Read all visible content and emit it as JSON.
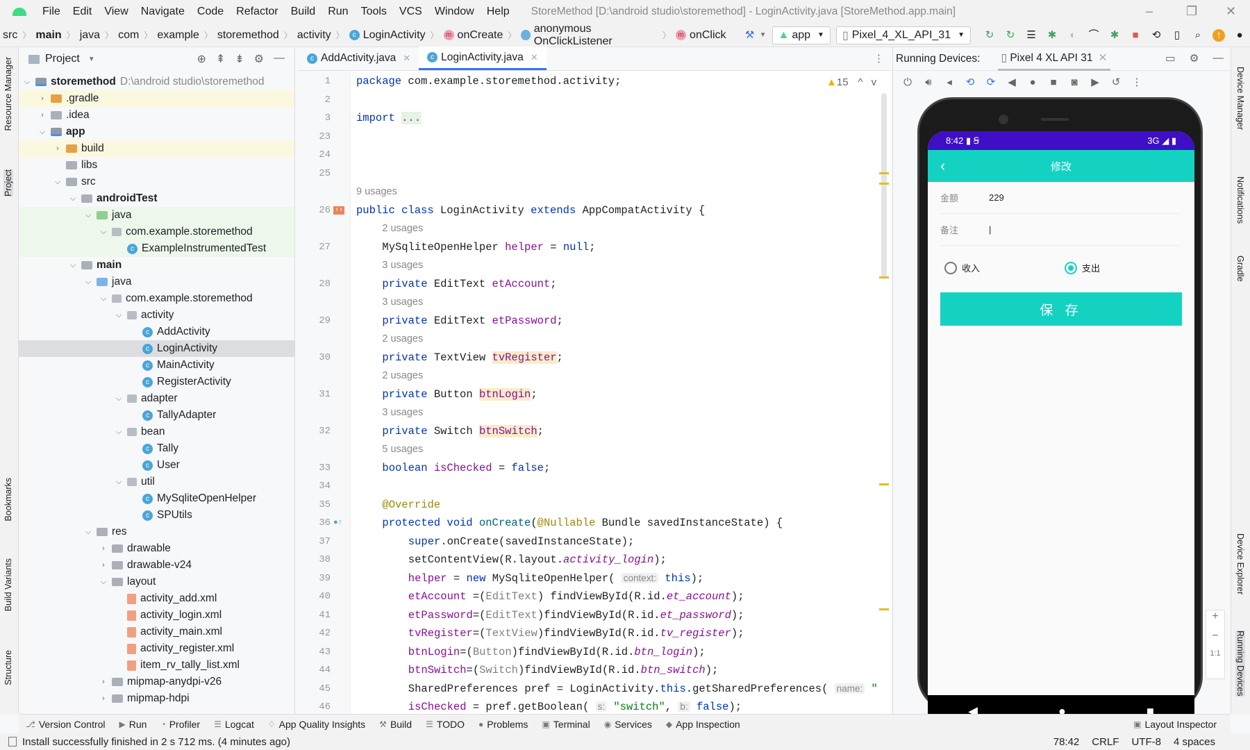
{
  "menubar": {
    "items": [
      "File",
      "Edit",
      "View",
      "Navigate",
      "Code",
      "Refactor",
      "Build",
      "Run",
      "Tools",
      "VCS",
      "Window",
      "Help"
    ],
    "title": "StoreMethod [D:\\android studio\\storemethod] - LoginActivity.java [StoreMethod.app.main]"
  },
  "breadcrumb": {
    "items": [
      "src",
      "main",
      "java",
      "com",
      "example",
      "storemethod",
      "activity"
    ],
    "class": "LoginActivity",
    "method": "onCreate",
    "anon": "anonymous OnClickListener",
    "inner": "onClick"
  },
  "toolbar": {
    "config": "app",
    "device": "Pixel_4_XL_API_31"
  },
  "left_strip": [
    "Resource Manager",
    "Project",
    "Bookmarks",
    "Build Variants",
    "Structure"
  ],
  "right_strip": [
    "Device Manager",
    "Notifications",
    "Gradle",
    "Device Explorer",
    "Running Devices"
  ],
  "project": {
    "title": "Project",
    "tree": [
      {
        "d": 0,
        "a": "v",
        "i": "mod",
        "l": "storemethod",
        "b": true,
        "p": "D:\\android studio\\storemethod"
      },
      {
        "d": 1,
        "a": ">",
        "i": "orange",
        "l": ".gradle",
        "bg": "#fbf8e0"
      },
      {
        "d": 1,
        "a": ">",
        "i": "",
        "l": ".idea"
      },
      {
        "d": 1,
        "a": "v",
        "i": "mod",
        "l": "app",
        "b": true
      },
      {
        "d": 2,
        "a": ">",
        "i": "orange",
        "l": "build",
        "bg": "#fbf8e0"
      },
      {
        "d": 2,
        "a": "",
        "i": "",
        "l": "libs"
      },
      {
        "d": 2,
        "a": "v",
        "i": "",
        "l": "src"
      },
      {
        "d": 3,
        "a": "v",
        "i": "",
        "l": "androidTest",
        "b": true
      },
      {
        "d": 4,
        "a": "v",
        "i": "green",
        "l": "java",
        "bg": "#eef7ec"
      },
      {
        "d": 5,
        "a": "v",
        "i": "pkg",
        "l": "com.example.storemethod",
        "bg": "#eef7ec"
      },
      {
        "d": 6,
        "a": "",
        "i": "class",
        "l": "ExampleInstrumentedTest",
        "bg": "#eef7ec"
      },
      {
        "d": 3,
        "a": "v",
        "i": "",
        "l": "main",
        "b": true
      },
      {
        "d": 4,
        "a": "v",
        "i": "blue",
        "l": "java"
      },
      {
        "d": 5,
        "a": "v",
        "i": "pkg",
        "l": "com.example.storemethod"
      },
      {
        "d": 6,
        "a": "v",
        "i": "pkg",
        "l": "activity"
      },
      {
        "d": 7,
        "a": "",
        "i": "class",
        "l": "AddActivity"
      },
      {
        "d": 7,
        "a": "",
        "i": "class",
        "l": "LoginActivity",
        "bg": "#dcdde0"
      },
      {
        "d": 7,
        "a": "",
        "i": "class",
        "l": "MainActivity"
      },
      {
        "d": 7,
        "a": "",
        "i": "class",
        "l": "RegisterActivity"
      },
      {
        "d": 6,
        "a": "v",
        "i": "pkg",
        "l": "adapter"
      },
      {
        "d": 7,
        "a": "",
        "i": "class",
        "l": "TallyAdapter"
      },
      {
        "d": 6,
        "a": "v",
        "i": "pkg",
        "l": "bean"
      },
      {
        "d": 7,
        "a": "",
        "i": "class",
        "l": "Tally"
      },
      {
        "d": 7,
        "a": "",
        "i": "class",
        "l": "User"
      },
      {
        "d": 6,
        "a": "v",
        "i": "pkg",
        "l": "util"
      },
      {
        "d": 7,
        "a": "",
        "i": "class",
        "l": "MySqliteOpenHelper"
      },
      {
        "d": 7,
        "a": "",
        "i": "class",
        "l": "SPUtils"
      },
      {
        "d": 4,
        "a": "v",
        "i": "",
        "l": "res"
      },
      {
        "d": 5,
        "a": ">",
        "i": "",
        "l": "drawable"
      },
      {
        "d": 5,
        "a": ">",
        "i": "",
        "l": "drawable-v24"
      },
      {
        "d": 5,
        "a": "v",
        "i": "",
        "l": "layout"
      },
      {
        "d": 6,
        "a": "",
        "i": "xml",
        "l": "activity_add.xml"
      },
      {
        "d": 6,
        "a": "",
        "i": "xml",
        "l": "activity_login.xml"
      },
      {
        "d": 6,
        "a": "",
        "i": "xml",
        "l": "activity_main.xml"
      },
      {
        "d": 6,
        "a": "",
        "i": "xml",
        "l": "activity_register.xml"
      },
      {
        "d": 6,
        "a": "",
        "i": "xml",
        "l": "item_rv_tally_list.xml"
      },
      {
        "d": 5,
        "a": ">",
        "i": "",
        "l": "mipmap-anydpi-v26"
      },
      {
        "d": 5,
        "a": ">",
        "i": "",
        "l": "mipmap-hdpi"
      }
    ]
  },
  "editor": {
    "tabs": [
      "AddActivity.java",
      "LoginActivity.java"
    ],
    "warnings": "15",
    "rows": [
      {
        "n": "1",
        "i": 0,
        "t": [
          [
            "kw",
            "package "
          ],
          [
            "",
            "com.example.storemethod.activity;"
          ]
        ]
      },
      {
        "n": "2",
        "i": 0,
        "t": []
      },
      {
        "n": "3",
        "i": 0,
        "t": [
          [
            "kw",
            "import "
          ],
          [
            "fold",
            "..."
          ]
        ]
      },
      {
        "n": "23",
        "i": 0,
        "t": []
      },
      {
        "n": "24",
        "i": 0,
        "t": []
      },
      {
        "n": "25",
        "i": 0,
        "t": []
      },
      {
        "u": "9 usages",
        "i": 0
      },
      {
        "n": "26",
        "i": 0,
        "t": [
          [
            "kw",
            "public class "
          ],
          [
            "",
            "LoginActivity "
          ],
          [
            "kw",
            "extends "
          ],
          [
            "",
            "AppCompatActivity {"
          ]
        ]
      },
      {
        "u": "2 usages",
        "i": 1
      },
      {
        "n": "27",
        "i": 1,
        "t": [
          [
            "",
            "MySqliteOpenHelper "
          ],
          [
            "fld",
            "helper"
          ],
          [
            "",
            " = "
          ],
          [
            "kw",
            "null"
          ],
          [
            "",
            ";"
          ]
        ]
      },
      {
        "u": "3 usages",
        "i": 1
      },
      {
        "n": "28",
        "i": 1,
        "t": [
          [
            "kw",
            "private "
          ],
          [
            "",
            "EditText "
          ],
          [
            "fld",
            "etAccount"
          ],
          [
            "",
            ";"
          ]
        ]
      },
      {
        "u": "3 usages",
        "i": 1
      },
      {
        "n": "29",
        "i": 1,
        "t": [
          [
            "kw",
            "private "
          ],
          [
            "",
            "EditText "
          ],
          [
            "fld",
            "etPassword"
          ],
          [
            "",
            ";"
          ]
        ]
      },
      {
        "u": "2 usages",
        "i": 1
      },
      {
        "n": "30",
        "i": 1,
        "t": [
          [
            "kw",
            "private "
          ],
          [
            "",
            "TextView "
          ],
          [
            "fld hl",
            "tvRegister"
          ],
          [
            "",
            ";"
          ]
        ]
      },
      {
        "u": "2 usages",
        "i": 1
      },
      {
        "n": "31",
        "i": 1,
        "t": [
          [
            "kw",
            "private "
          ],
          [
            "",
            "Button "
          ],
          [
            "fld hl",
            "btnLogin"
          ],
          [
            "",
            ";"
          ]
        ]
      },
      {
        "u": "3 usages",
        "i": 1
      },
      {
        "n": "32",
        "i": 1,
        "t": [
          [
            "kw",
            "private "
          ],
          [
            "",
            "Switch "
          ],
          [
            "fld hl",
            "btnSwitch"
          ],
          [
            "",
            ";"
          ]
        ]
      },
      {
        "u": "5 usages",
        "i": 1
      },
      {
        "n": "33",
        "i": 1,
        "t": [
          [
            "kw",
            "boolean "
          ],
          [
            "fld",
            "isChecked"
          ],
          [
            "",
            " = "
          ],
          [
            "kw",
            "false"
          ],
          [
            "",
            ";"
          ]
        ]
      },
      {
        "n": "34",
        "i": 1,
        "t": []
      },
      {
        "n": "35",
        "i": 1,
        "t": [
          [
            "ann",
            "@Override"
          ]
        ]
      },
      {
        "n": "36",
        "i": 1,
        "t": [
          [
            "kw",
            "protected void "
          ],
          [
            "mth",
            "onCreate"
          ],
          [
            "",
            "("
          ],
          [
            "ann",
            "@Nullable"
          ],
          [
            "",
            " Bundle savedInstanceState) {"
          ]
        ]
      },
      {
        "n": "37",
        "i": 2,
        "t": [
          [
            "kw",
            "super"
          ],
          [
            "",
            ".onCreate(savedInstanceState);"
          ]
        ]
      },
      {
        "n": "38",
        "i": 2,
        "t": [
          [
            "",
            "setContentView(R.layout."
          ],
          [
            "it",
            "activity_login"
          ],
          [
            "",
            ");"
          ]
        ]
      },
      {
        "n": "39",
        "i": 2,
        "t": [
          [
            "fld",
            "helper"
          ],
          [
            "",
            " = "
          ],
          [
            "kw",
            "new "
          ],
          [
            "",
            "MySqliteOpenHelper( "
          ],
          [
            "hint",
            "context:"
          ],
          [
            "kw",
            " this"
          ],
          [
            "",
            ");"
          ]
        ]
      },
      {
        "n": "40",
        "i": 2,
        "t": [
          [
            "fld",
            "etAccount"
          ],
          [
            "",
            " =("
          ],
          [
            "cast",
            "EditText"
          ],
          [
            "",
            ") findViewById(R.id."
          ],
          [
            "it",
            "et_account"
          ],
          [
            "",
            ");"
          ]
        ]
      },
      {
        "n": "41",
        "i": 2,
        "t": [
          [
            "fld",
            "etPassword"
          ],
          [
            "",
            "=("
          ],
          [
            "cast",
            "EditText"
          ],
          [
            "",
            ")findViewById(R.id."
          ],
          [
            "it",
            "et_password"
          ],
          [
            "",
            ");"
          ]
        ]
      },
      {
        "n": "42",
        "i": 2,
        "t": [
          [
            "fld",
            "tvRegister"
          ],
          [
            "",
            "=("
          ],
          [
            "cast",
            "TextView"
          ],
          [
            "",
            ")findViewById(R.id."
          ],
          [
            "it",
            "tv_register"
          ],
          [
            "",
            ");"
          ]
        ]
      },
      {
        "n": "43",
        "i": 2,
        "t": [
          [
            "fld",
            "btnLogin"
          ],
          [
            "",
            "=("
          ],
          [
            "cast",
            "Button"
          ],
          [
            "",
            ")findViewById(R.id."
          ],
          [
            "it",
            "btn_login"
          ],
          [
            "",
            ");"
          ]
        ]
      },
      {
        "n": "44",
        "i": 2,
        "t": [
          [
            "fld",
            "btnSwitch"
          ],
          [
            "",
            "=("
          ],
          [
            "cast",
            "Switch"
          ],
          [
            "",
            ")findViewById(R.id."
          ],
          [
            "it",
            "btn_switch"
          ],
          [
            "",
            ");"
          ]
        ]
      },
      {
        "n": "45",
        "i": 2,
        "t": [
          [
            "",
            "SharedPreferences pref = LoginActivity."
          ],
          [
            "kw",
            "this"
          ],
          [
            "",
            ".getSharedPreferences( "
          ],
          [
            "hint",
            "name:"
          ],
          [
            "str",
            " \""
          ]
        ]
      },
      {
        "n": "46",
        "i": 2,
        "t": [
          [
            "fld",
            "isChecked"
          ],
          [
            "",
            " = pref.getBoolean( "
          ],
          [
            "hint",
            "s:"
          ],
          [
            "str",
            " \"switch\""
          ],
          [
            "",
            ", "
          ],
          [
            "hint",
            "b:"
          ],
          [
            "kw",
            " false"
          ],
          [
            "",
            ");"
          ]
        ]
      }
    ]
  },
  "running": {
    "label": "Running Devices:",
    "device_tab": "Pixel 4 XL API 31",
    "zoom": [
      "+",
      "−",
      "1:1"
    ]
  },
  "phone": {
    "time": "8:42",
    "network": "3G",
    "title": "修改",
    "amount_label": "金额",
    "amount_value": "229",
    "note_label": "备注",
    "note_value": "|",
    "radio_income": "收入",
    "radio_expense": "支出",
    "selected": "支出",
    "save": "保 存"
  },
  "toolwindows": {
    "items": [
      "Version Control",
      "Run",
      "Profiler",
      "Logcat",
      "App Quality Insights",
      "Build",
      "TODO",
      "Problems",
      "Terminal",
      "Services",
      "App Inspection"
    ],
    "right": "Layout Inspector"
  },
  "status": {
    "message": "Install successfully finished in 2 s 712 ms. (4 minutes ago)",
    "position": "78:42",
    "line_sep": "CRLF",
    "encoding": "UTF-8",
    "indent": "4 spaces"
  }
}
